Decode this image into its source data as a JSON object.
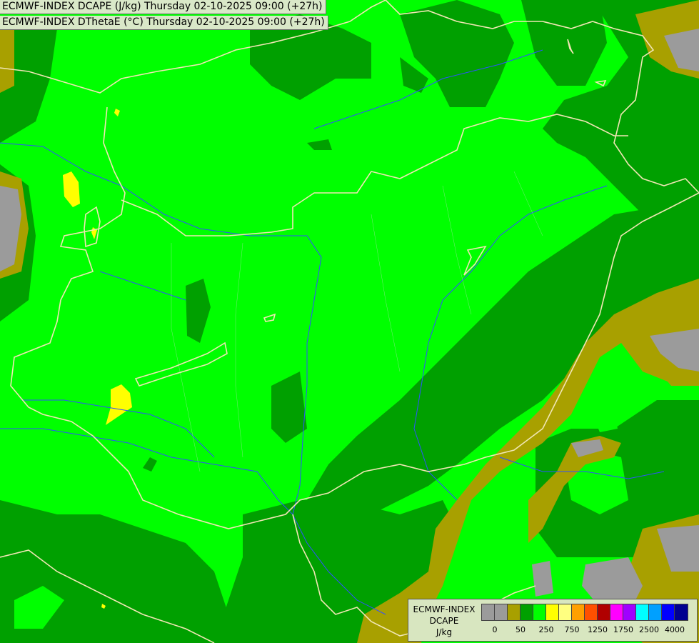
{
  "header": {
    "line1": "ECMWF-INDEX DCAPE (J/kg) Thursday 02-10-2025 09:00 (+27h)",
    "line2": "ECMWF-INDEX DThetaE (°C) Thursday 02-10-2025 09:00 (+27h)"
  },
  "legend": {
    "title_line1": "ECMWF-INDEX",
    "title_line2": "DCAPE",
    "unit": "J/kg",
    "colors": [
      "#9b9b9b",
      "#9b9b9b",
      "#a8a000",
      "#00a000",
      "#00ff00",
      "#ffff00",
      "#ffff80",
      "#ffa000",
      "#ff5000",
      "#b00000",
      "#ff00ff",
      "#a000ff",
      "#00ffff",
      "#00a0ff",
      "#0000ff",
      "#000090"
    ],
    "ticks": [
      {
        "label": "0",
        "pos": 1
      },
      {
        "label": "50",
        "pos": 3
      },
      {
        "label": "250",
        "pos": 5
      },
      {
        "label": "750",
        "pos": 7
      },
      {
        "label": "1250",
        "pos": 9
      },
      {
        "label": "1750",
        "pos": 11
      },
      {
        "label": "2500",
        "pos": 13
      },
      {
        "label": "4000",
        "pos": 15
      }
    ]
  },
  "colors": {
    "class_0": "#9b9b9b",
    "class_50": "#a8a000",
    "class_100": "#00a000",
    "class_250": "#00ff00",
    "class_500": "#ffff00",
    "borders": "#f0e6b4",
    "rivers": "#3050ff"
  }
}
